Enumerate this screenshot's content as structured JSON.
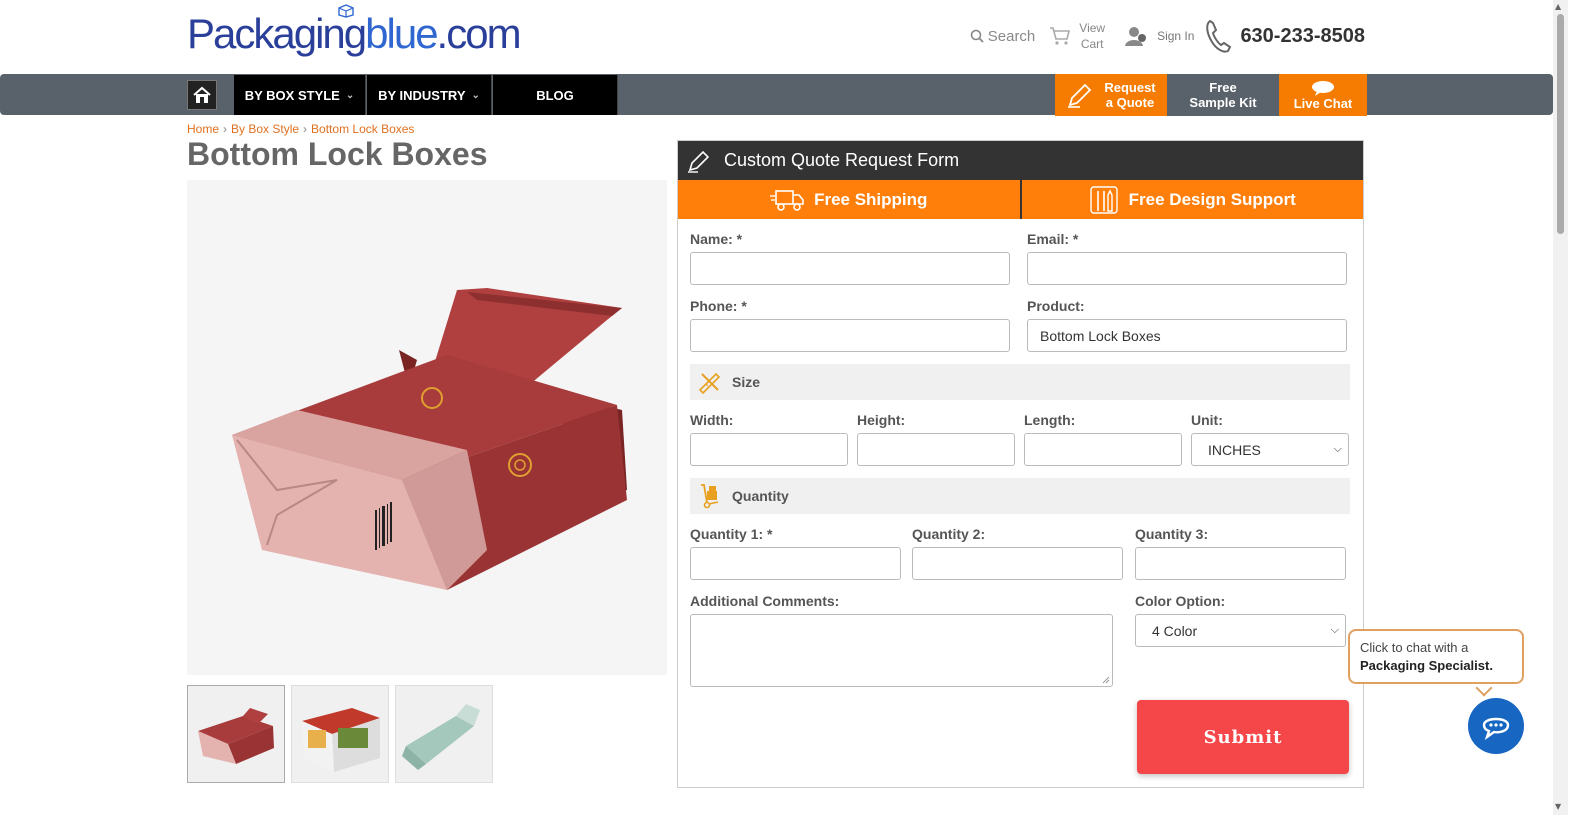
{
  "header": {
    "logo_text_1": "Packaging",
    "logo_text_2": "blue",
    "logo_text_3": ".com",
    "search_label": "Search",
    "cart_line1": "View",
    "cart_line2": "Cart",
    "signin_label": "Sign In",
    "phone": "630-233-8508"
  },
  "nav": {
    "items": [
      {
        "label": "BY BOX STYLE"
      },
      {
        "label": "BY INDUSTRY"
      },
      {
        "label": "BLOG"
      }
    ],
    "quote_line1": "Request",
    "quote_line2": "a Quote",
    "kit_line1": "Free",
    "kit_line2": "Sample Kit",
    "chat_label": "Live Chat"
  },
  "breadcrumb": [
    "Home",
    "By Box Style",
    "Bottom Lock Boxes"
  ],
  "page_title": "Bottom Lock Boxes",
  "form": {
    "title": "Custom Quote Request Form",
    "band_shipping": "Free Shipping",
    "band_design": "Free Design Support",
    "name_label": "Name: *",
    "email_label": "Email: *",
    "phone_label": "Phone: *",
    "product_label": "Product:",
    "product_value": "Bottom Lock Boxes",
    "size_section": "Size",
    "width_label": "Width:",
    "height_label": "Height:",
    "length_label": "Length:",
    "unit_label": "Unit:",
    "unit_value": "INCHES",
    "quantity_section": "Quantity",
    "qty1_label": "Quantity 1: *",
    "qty2_label": "Quantity 2:",
    "qty3_label": "Quantity 3:",
    "comments_label": "Additional Comments:",
    "color_label": "Color Option:",
    "color_value": "4 Color",
    "submit_label": "Submit"
  },
  "chat": {
    "line1": "Click to chat with a",
    "line2": "Packaging Specialist."
  },
  "colors": {
    "accent_orange": "#ff7f0a",
    "submit_red": "#f5474a",
    "nav_gray": "#59626a",
    "chat_blue": "#1766c2"
  }
}
